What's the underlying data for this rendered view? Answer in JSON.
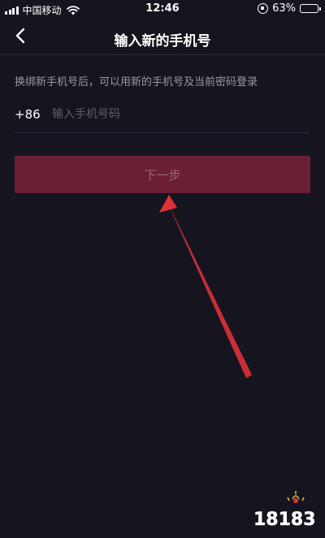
{
  "status_bar": {
    "carrier": "中国移动",
    "time": "12:46",
    "battery_percent": "63%",
    "battery_level": 0.63
  },
  "nav": {
    "title": "输入新的手机号"
  },
  "form": {
    "hint": "换绑新手机号后，可以用新的手机号及当前密码登录",
    "country_code": "+86",
    "phone_placeholder": "输入手机号码",
    "phone_value": "",
    "next_button_label": "下一步"
  },
  "annotation": {
    "arrow_color": "#e0303a"
  },
  "watermark": {
    "text": "18183"
  },
  "colors": {
    "background": "#16151f",
    "button_disabled": "#6a1f34",
    "hint_text": "#9b9aa3"
  }
}
